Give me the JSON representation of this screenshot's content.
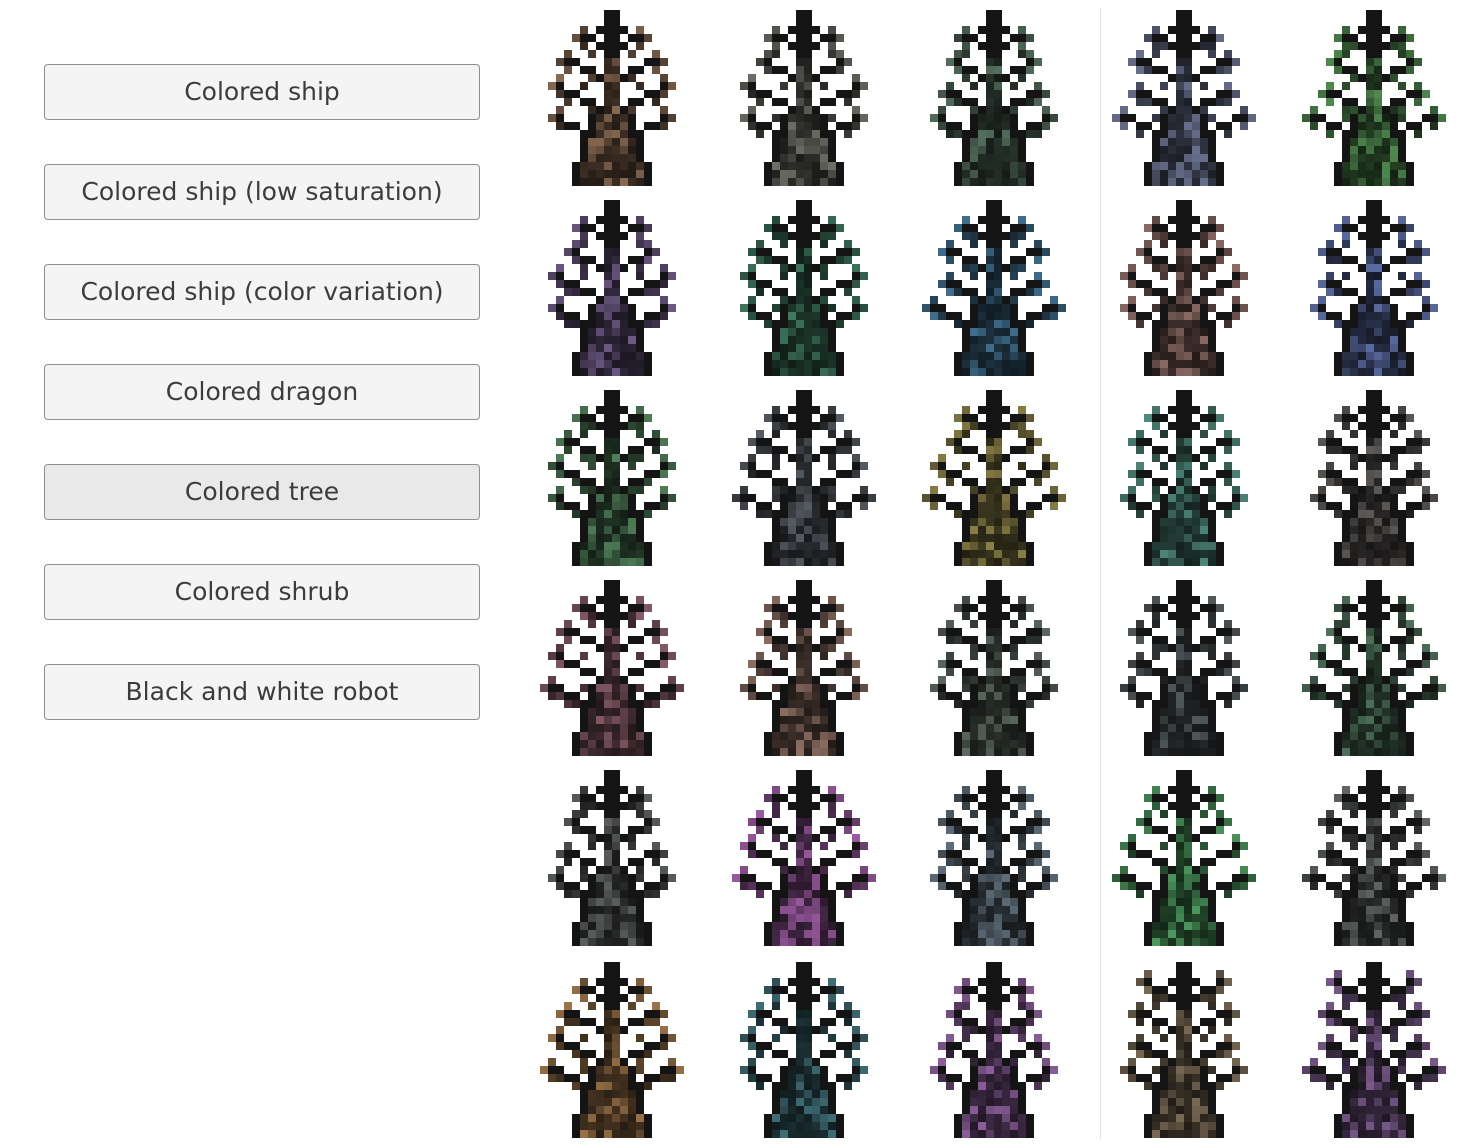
{
  "sidebar": {
    "buttons": [
      {
        "label": "Colored ship",
        "selected": false
      },
      {
        "label": "Colored ship (low saturation)",
        "selected": false
      },
      {
        "label": "Colored ship (color variation)",
        "selected": false
      },
      {
        "label": "Colored dragon",
        "selected": false
      },
      {
        "label": "Colored tree",
        "selected": true
      },
      {
        "label": "Colored shrub",
        "selected": false
      },
      {
        "label": "Black and white robot",
        "selected": false
      }
    ]
  },
  "sprite_grid": {
    "rows": 6,
    "columns": 5,
    "subject": "tree",
    "tints": [
      [
        "#8a6a52",
        "#6e6e66",
        "#55705e",
        "#6a7390",
        "#4f8a4f"
      ],
      [
        "#6e5a86",
        "#3f7a60",
        "#3f6e8c",
        "#8c6a64",
        "#5a6aa0"
      ],
      [
        "#4f7e58",
        "#585e66",
        "#8c8248",
        "#4f8a7c",
        "#5e5a58"
      ],
      [
        "#8a5e6a",
        "#8c6e62",
        "#5c6a60",
        "#525a5e",
        "#4c7058"
      ],
      [
        "#5a5e5c",
        "#9a5aa0",
        "#5e6e7a",
        "#4c9a5e",
        "#5e6462"
      ],
      [
        "#9a7248",
        "#3f6e76",
        "#8a5e9a",
        "#7a6a54",
        "#7a5a8c"
      ]
    ]
  }
}
